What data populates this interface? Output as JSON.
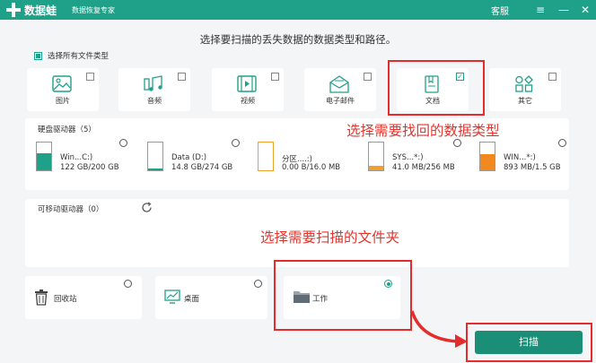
{
  "app": {
    "name": "数据蛙",
    "tagline": "数据恢复专家",
    "service": "客服"
  },
  "window_controls": {
    "menu": "≡",
    "minimize": "—",
    "close": "✕"
  },
  "main": {
    "title": "选择要扫描的丢失数据的数据类型和路径。"
  },
  "file_types": {
    "select_all_label": "选择所有文件类型",
    "items": [
      {
        "label": "图片",
        "checked": false,
        "icon": "image-icon"
      },
      {
        "label": "音频",
        "checked": false,
        "icon": "music-icon"
      },
      {
        "label": "视频",
        "checked": false,
        "icon": "video-icon"
      },
      {
        "label": "电子邮件",
        "checked": false,
        "icon": "mail-icon"
      },
      {
        "label": "文档",
        "checked": true,
        "icon": "document-icon",
        "check_mark": "✓"
      },
      {
        "label": "其它",
        "checked": false,
        "icon": "other-icon"
      }
    ]
  },
  "drives": {
    "title": "硬盘驱动器（5）",
    "items": [
      {
        "name": "Win...C:)",
        "size": "122 GB/200 GB",
        "fill": 0.61,
        "color": "#1fa088"
      },
      {
        "name": "Data (D:)",
        "size": "14.8 GB/274 GB",
        "fill": 0.05,
        "color": "#1fa088"
      },
      {
        "name": "分区....:)",
        "size": "0.00  B/16.0 MB",
        "fill": 0.0,
        "color": "#f0a030"
      },
      {
        "name": "SYS...*:)",
        "size": "41.0 MB/256 MB",
        "fill": 0.16,
        "color": "#f0a030"
      },
      {
        "name": "WIN...*:)",
        "size": "893 MB/1.5 GB",
        "fill": 0.58,
        "color": "#f08a20"
      }
    ]
  },
  "removable": {
    "title": "可移动驱动器（0）",
    "refresh_icon": "refresh-icon"
  },
  "folders": [
    {
      "label": "回收站",
      "icon": "recycle-bin-icon",
      "selected": false
    },
    {
      "label": "桌面",
      "icon": "desktop-icon",
      "selected": false
    },
    {
      "label": "工作",
      "icon": "folder-icon",
      "selected": true
    }
  ],
  "annotations": {
    "choose_type": "选择需要找回的数据类型",
    "choose_folder": "选择需要扫描的文件夹"
  },
  "scan_button": {
    "label": "扫描"
  },
  "colors": {
    "accent": "#1fa088",
    "annotation_red": "#e4342c"
  }
}
